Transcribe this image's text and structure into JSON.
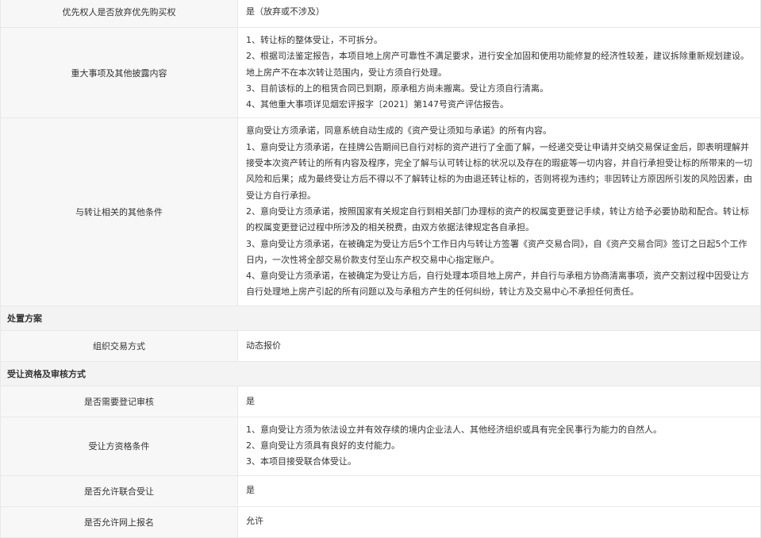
{
  "rows_top": [
    {
      "label": "优先权人是否放弃优先购买权",
      "lines": [
        "是（放弃或不涉及）"
      ]
    },
    {
      "label": "重大事项及其他披露内容",
      "lines": [
        "1、转让标的整体受让，不可拆分。",
        "2、根据司法鉴定报告，本项目地上房产可靠性不满足要求，进行安全加固和使用功能修复的经济性较差，建议拆除重新规划建设。地上房产不在本次转让范围内，受让方须自行处理。",
        "3、目前该标的上的租赁合同已到期，原承租方尚未搬离。受让方须自行清离。",
        "4、其他重大事项详见烟宏评报字〔2021〕第147号资产评估报告。"
      ]
    },
    {
      "label": "与转让相关的其他条件",
      "lines": [
        "意向受让方须承诺，同意系统自动生成的《资产受让须知与承诺》的所有内容。",
        "1、意向受让方须承诺，在挂牌公告期间已自行对标的资产进行了全面了解，一经递交受让申请并交纳交易保证金后，即表明理解并接受本次资产转让的所有内容及程序，完全了解与认可转让标的状况以及存在的瑕疵等一切内容，并自行承担受让标的所带来的一切风险和后果；成为最终受让方后不得以不了解转让标的为由退还转让标的，否则将视为违约；非因转让方原因所引发的风险因素，由受让方自行承担。",
        "2、意向受让方须承诺，按照国家有关规定自行到相关部门办理标的资产的权属变更登记手续，转让方给予必要协助和配合。转让标的权属变更登记过程中所涉及的相关税费，由双方依据法律规定各自承担。",
        "3、意向受让方须承诺，在被确定为受让方后5个工作日内与转让方签署《资产交易合同》，自《资产交易合同》签订之日起5个工作日内，一次性将全部交易价款支付至山东产权交易中心指定账户。",
        "4、意向受让方须承诺，在被确定为受让方后，自行处理本项目地上房产，并自行与承租方协商清离事项，资产交割过程中因受让方自行处理地上房产引起的所有问题以及与承租方产生的任何纠纷，转让方及交易中心不承担任何责任。"
      ]
    }
  ],
  "section_disposal": "处置方案",
  "row_trade": {
    "label": "组织交易方式",
    "value": "动态报价"
  },
  "section_qual": "受让资格及审核方式",
  "row_reg": {
    "label": "是否需要登记审核",
    "value": "是"
  },
  "row_cond": {
    "label": "受让方资格条件",
    "lines": [
      "1、意向受让方须为依法设立并有效存续的境内企业法人、其他经济组织或具有完全民事行为能力的自然人。",
      "2、意向受让方须具有良好的支付能力。",
      "3、本项目接受联合体受让。"
    ]
  },
  "row_joint": {
    "label": "是否允许联合受让",
    "value": "是"
  },
  "row_online": {
    "label": "是否允许网上报名",
    "value": "允许"
  }
}
